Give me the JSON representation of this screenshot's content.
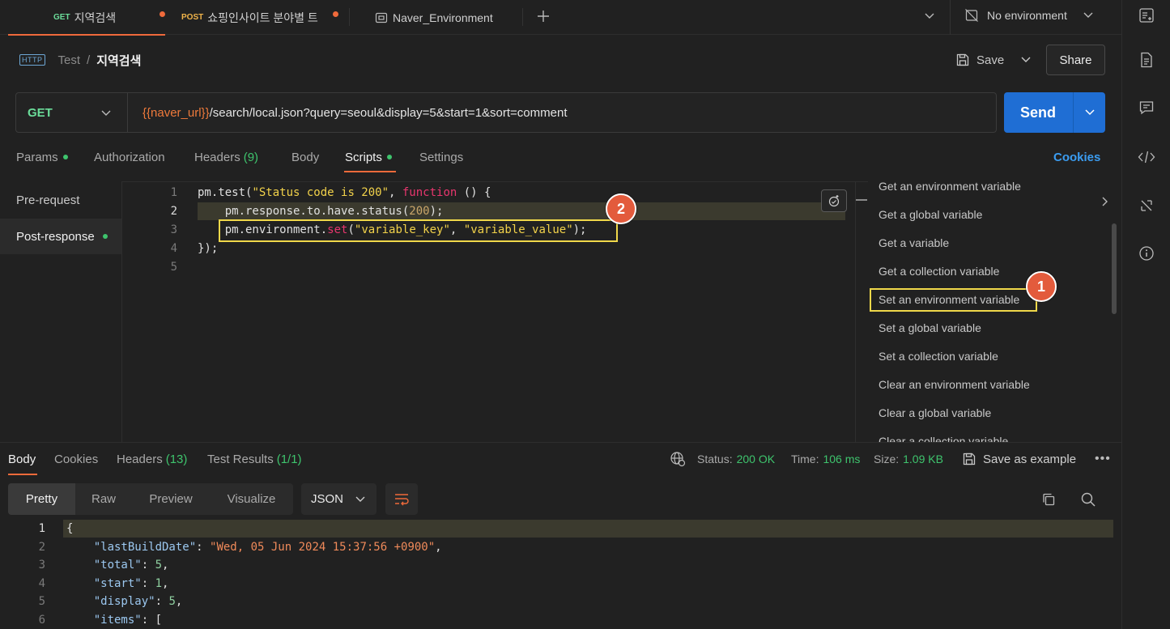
{
  "tabs": [
    {
      "method": "GET",
      "label": "지역검색",
      "unsaved": true
    },
    {
      "method": "POST",
      "label": "쇼핑인사이트 분야별 트",
      "unsaved": true
    },
    {
      "label": "Naver_Environment"
    }
  ],
  "environment": {
    "selected": "No environment"
  },
  "breadcrumb": {
    "badge": "HTTP",
    "collection": "Test",
    "separator": "/",
    "request": "지역검색"
  },
  "header": {
    "save_label": "Save",
    "share_label": "Share"
  },
  "request": {
    "method": "GET",
    "url_variable": "{{naver_url}}",
    "url_path": "/search/local.json?query=seoul&display=5&start=1&sort=comment",
    "send_label": "Send"
  },
  "request_tabs": {
    "params": "Params",
    "authorization": "Authorization",
    "headers": "Headers",
    "headers_count": "(9)",
    "body": "Body",
    "scripts": "Scripts",
    "settings": "Settings",
    "cookies": "Cookies"
  },
  "script_sidebar": {
    "pre_request": "Pre-request",
    "post_response": "Post-response"
  },
  "editor": {
    "line_numbers": [
      "1",
      "2",
      "3",
      "4",
      "5"
    ],
    "line1": {
      "a": "pm.test(",
      "b": "\"Status code is 200\"",
      "c": ", ",
      "d": "function",
      "e": " () {"
    },
    "line2": {
      "a": "    pm.response.to.have.status(",
      "b": "200",
      "c": ");"
    },
    "line3": {
      "a": "    pm.environment.",
      "b": "set",
      "c": "(",
      "d": "\"variable_key\"",
      "e": ", ",
      "f": "\"variable_value\"",
      "g": ");"
    },
    "line4": {
      "a": "});"
    }
  },
  "annotations": {
    "badge1": "1",
    "badge2": "2"
  },
  "snippets": [
    "Get an environment variable",
    "Get a global variable",
    "Get a variable",
    "Get a collection variable",
    "Set an environment variable",
    "Set a global variable",
    "Set a collection variable",
    "Clear an environment variable",
    "Clear a global variable",
    "Clear a collection variable"
  ],
  "response_tabs": {
    "body": "Body",
    "cookies": "Cookies",
    "headers": "Headers",
    "headers_count": "(13)",
    "test_results": "Test Results",
    "test_results_count": "(1/1)"
  },
  "response_status": {
    "status_label": "Status:",
    "status_value": "200 OK",
    "time_label": "Time:",
    "time_value": "106 ms",
    "size_label": "Size:",
    "size_value": "1.09 KB",
    "save_example": "Save as example",
    "more": "•••"
  },
  "view_tabs": [
    "Pretty",
    "Raw",
    "Preview",
    "Visualize"
  ],
  "format_select": "JSON",
  "response_body": {
    "line_numbers": [
      "1",
      "2",
      "3",
      "4",
      "5",
      "6"
    ],
    "l1": "{",
    "l2_key": "\"lastBuildDate\"",
    "l2_val": "\"Wed, 05 Jun 2024 15:37:56 +0900\"",
    "l3_key": "\"total\"",
    "l3_val": "5",
    "l4_key": "\"start\"",
    "l4_val": "1",
    "l5_key": "\"display\"",
    "l5_val": "5",
    "l6_key": "\"items\"",
    "l6_val": "[",
    "colon": ": ",
    "comma": ","
  },
  "colors": {
    "accent": "#ef6a3b",
    "send": "#1f6ed4",
    "highlight": "#f0d84a",
    "success": "#3ec46d"
  }
}
